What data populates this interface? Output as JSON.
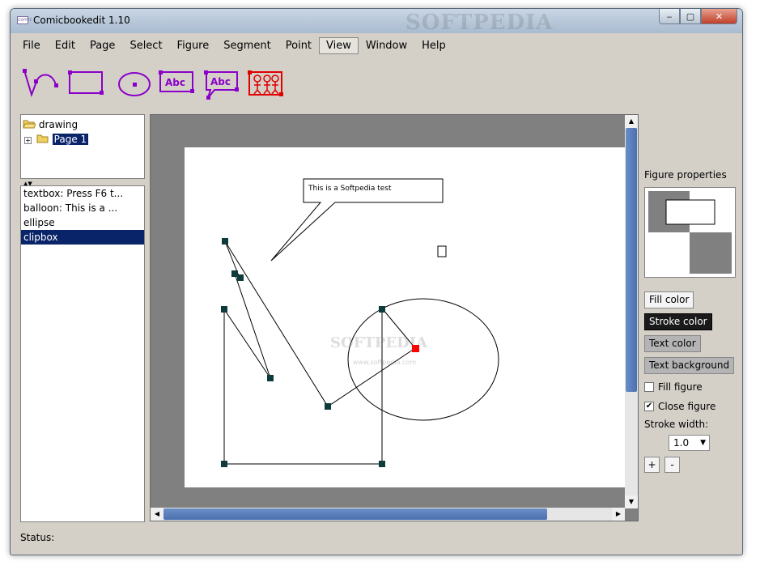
{
  "window": {
    "title": "Comicbookedit 1.10",
    "watermark": "SOFTPEDIA",
    "icon_text": "comic",
    "controls": {
      "minimize": "‒",
      "maximize": "▢",
      "close": "✕"
    }
  },
  "menu": [
    {
      "label": "File"
    },
    {
      "label": "Edit"
    },
    {
      "label": "Page"
    },
    {
      "label": "Select"
    },
    {
      "label": "Figure"
    },
    {
      "label": "Segment"
    },
    {
      "label": "Point"
    },
    {
      "label": "View",
      "active": true
    },
    {
      "label": "Window"
    },
    {
      "label": "Help"
    }
  ],
  "toolbar": {
    "tools": [
      "curve-tool-icon",
      "rectangle-tool-icon",
      "ellipse-tool-icon",
      "textbox-tool-icon",
      "balloon-tool-icon",
      "clipbox-tool-icon"
    ],
    "textbox_label": "Abc",
    "balloon_label": "Abc"
  },
  "tree": {
    "root": "drawing",
    "child": "Page 1",
    "expander": "+"
  },
  "splitter": "▲▼",
  "figure_list": [
    {
      "label": "textbox: Press F6 t..."
    },
    {
      "label": "balloon: This is a ..."
    },
    {
      "label": "ellipse"
    },
    {
      "label": "clipbox",
      "selected": true
    }
  ],
  "canvas": {
    "balloon_text": "This is a Softpedia test",
    "watermark": "SOFTPEDIA",
    "watermark_url": "www.softpedia.com"
  },
  "properties": {
    "title": "Figure properties",
    "fill_color_btn": "Fill color",
    "stroke_color_btn": "Stroke color",
    "text_color_btn": "Text color",
    "text_background_btn": "Text background",
    "fill_figure": {
      "label": "Fill figure",
      "checked": false
    },
    "close_figure": {
      "label": "Close figure",
      "checked": true
    },
    "stroke_width_label": "Stroke width:",
    "stroke_width_value": "1.0",
    "plus": "+",
    "minus": "-"
  },
  "status": {
    "label": "Status:"
  },
  "colors": {
    "tool_purple": "#8a00c8",
    "tool_red": "#e00000",
    "handle": "#0e3b3b",
    "selected_handle": "#ff0000",
    "selection": "#0a246a"
  }
}
